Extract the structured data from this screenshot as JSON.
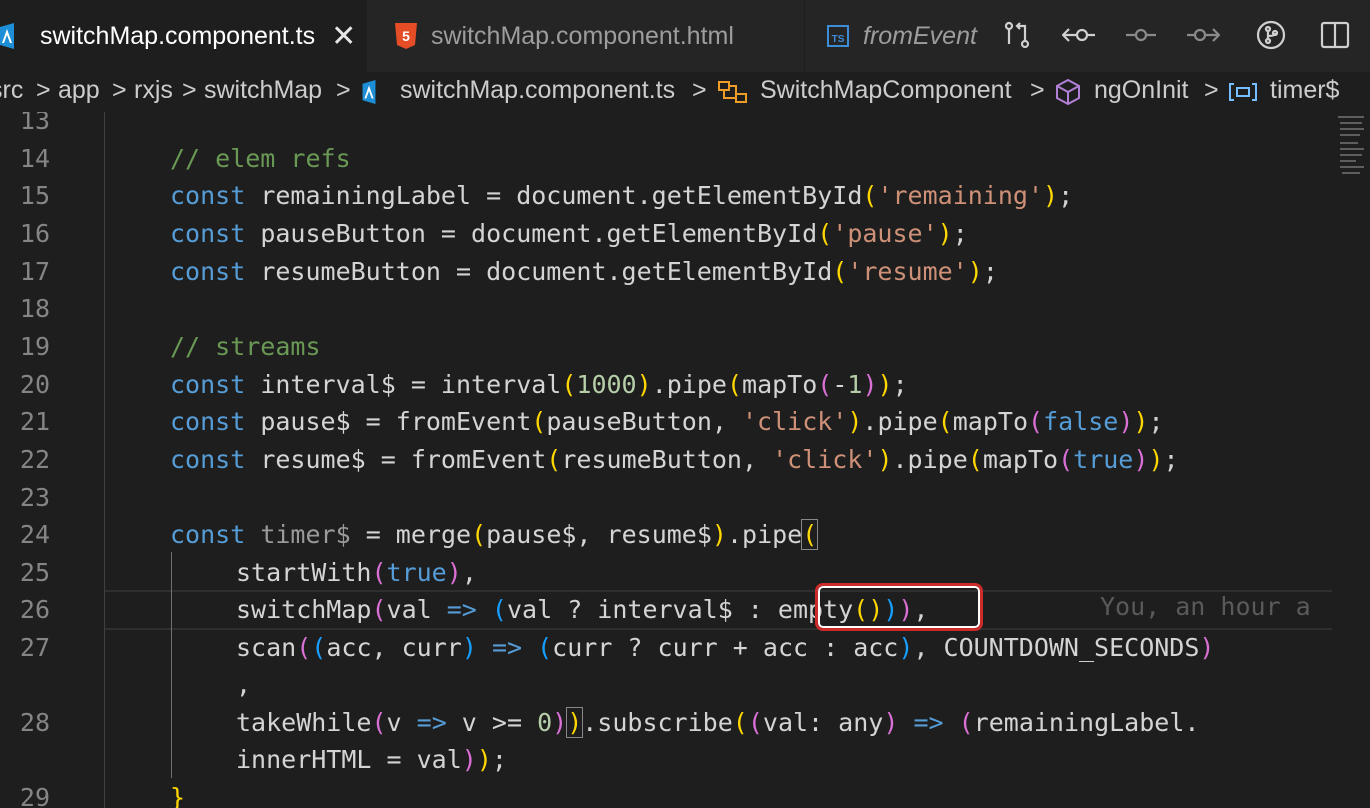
{
  "tabs": [
    {
      "label": "switchMap.component.ts",
      "close": "✕",
      "icon": "angular-icon",
      "active": true
    },
    {
      "label": "switchMap.component.html",
      "icon": "html5-icon",
      "active": false
    },
    {
      "label": "fromEvent",
      "icon": "typescript-icon",
      "active": false
    }
  ],
  "toolbar_icons": [
    "compare-changes-icon",
    "go-back-icon",
    "commit-icon",
    "go-forward-icon",
    "git-graph-icon",
    "split-editor-icon"
  ],
  "breadcrumb": {
    "items": [
      "src",
      "app",
      "rxjs",
      "switchMap",
      "switchMap.component.ts",
      "SwitchMapComponent",
      "ngOnInit",
      "timer$"
    ],
    "separator": ">"
  },
  "editor": {
    "line_numbers": [
      "13",
      "14",
      "15",
      "16",
      "17",
      "18",
      "19",
      "20",
      "21",
      "22",
      "23",
      "24",
      "25",
      "26",
      "27",
      "",
      "28",
      "",
      "29"
    ],
    "blame_text": "You, an hour a"
  },
  "colors": {
    "keyword": "#569cd6",
    "comment": "#6a9955",
    "string": "#ce9178",
    "number": "#b5cea8",
    "highlight_box": "#cc2b2b"
  }
}
